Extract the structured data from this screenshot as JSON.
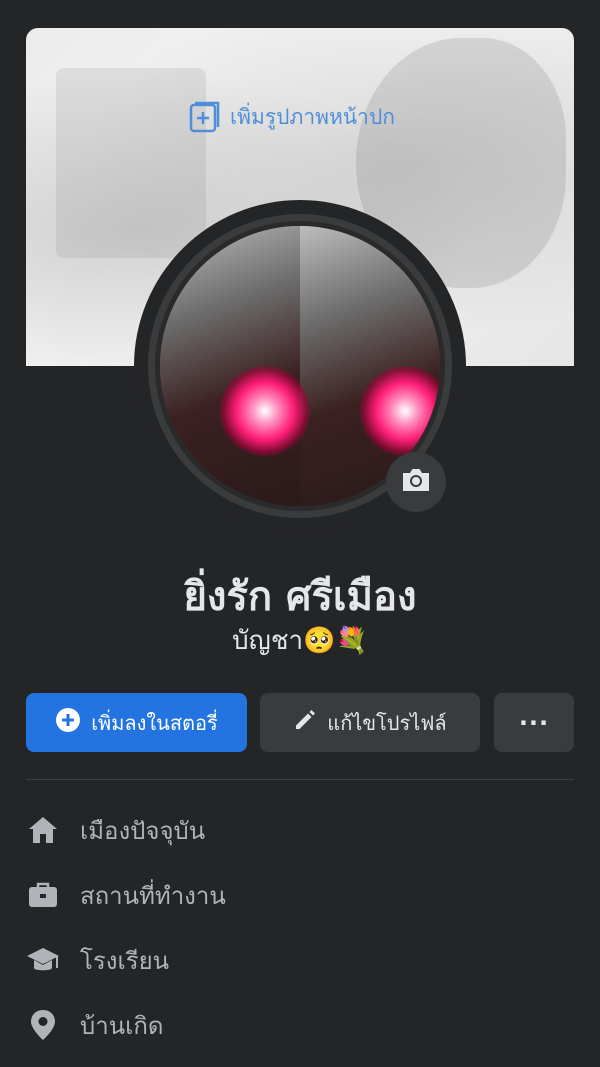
{
  "cover": {
    "add_label": "เพิ่มรูปภาพหน้าปก"
  },
  "profile": {
    "name": "ยิ่งรัก ศรีเมือง",
    "bio": "บัญชา🥺💐"
  },
  "actions": {
    "add_story_label": "เพิ่มลงในสตอรี่",
    "edit_profile_label": "แก้ไขโปรไฟล์",
    "more_label": "···"
  },
  "details": [
    {
      "icon": "home-icon",
      "label": "เมืองปัจจุบัน"
    },
    {
      "icon": "briefcase-icon",
      "label": "สถานที่ทำงาน"
    },
    {
      "icon": "graduation-cap-icon",
      "label": "โรงเรียน"
    },
    {
      "icon": "location-pin-icon",
      "label": "บ้านเกิด"
    }
  ],
  "colors": {
    "background": "#242526",
    "primary": "#2374e1",
    "secondary_button": "#3a3b3c",
    "text": "#e4e6eb",
    "muted_text": "#b0b3b8",
    "cover_link": "#4f8fd9"
  }
}
